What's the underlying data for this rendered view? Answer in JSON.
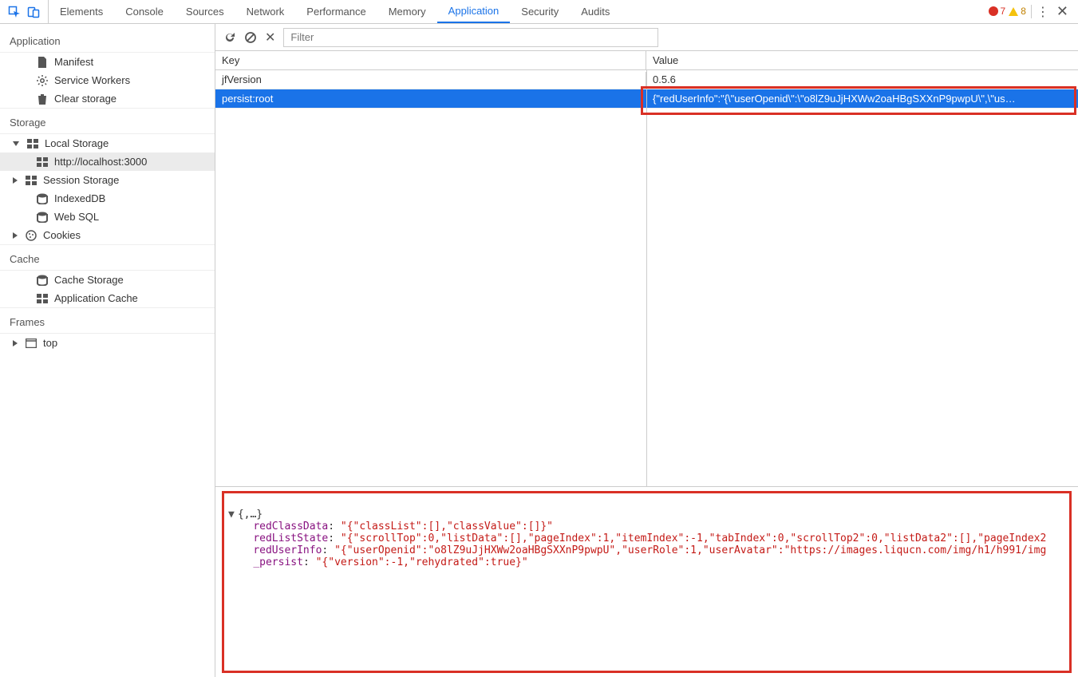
{
  "tabs": [
    "Elements",
    "Console",
    "Sources",
    "Network",
    "Performance",
    "Memory",
    "Application",
    "Security",
    "Audits"
  ],
  "active_tab": "Application",
  "status": {
    "errors": 7,
    "warnings": 8
  },
  "sidebar": {
    "application": {
      "title": "Application",
      "items": [
        "Manifest",
        "Service Workers",
        "Clear storage"
      ]
    },
    "storage": {
      "title": "Storage",
      "local_storage": "Local Storage",
      "local_storage_child": "http://localhost:3000",
      "session_storage": "Session Storage",
      "indexeddb": "IndexedDB",
      "websql": "Web SQL",
      "cookies": "Cookies"
    },
    "cache": {
      "title": "Cache",
      "items": [
        "Cache Storage",
        "Application Cache"
      ]
    },
    "frames": {
      "title": "Frames",
      "top": "top"
    }
  },
  "toolbar": {
    "filter_placeholder": "Filter"
  },
  "table": {
    "headers": {
      "key": "Key",
      "value": "Value"
    },
    "rows": [
      {
        "key": "jfVersion",
        "value": "0.5.6",
        "selected": false
      },
      {
        "key": "persist:root",
        "value": "{\"redUserInfo\":\"{\\\"userOpenid\\\":\\\"o8lZ9uJjHXWw2oaHBgSXXnP9pwpU\\\",\\\"us…",
        "selected": true
      }
    ]
  },
  "detail": {
    "header": "{,…}",
    "redClassData": "\"{\"classList\":[],\"classValue\":[]}\"",
    "redListState": "\"{\"scrollTop\":0,\"listData\":[],\"pageIndex\":1,\"itemIndex\":-1,\"tabIndex\":0,\"scrollTop2\":0,\"listData2\":[],\"pageIndex2",
    "redUserInfo": "\"{\"userOpenid\":\"o8lZ9uJjHXWw2oaHBgSXXnP9pwpU\",\"userRole\":1,\"userAvatar\":\"https://images.liqucn.com/img/h1/h991/img",
    "_persist": "\"{\"version\":-1,\"rehydrated\":true}\""
  }
}
